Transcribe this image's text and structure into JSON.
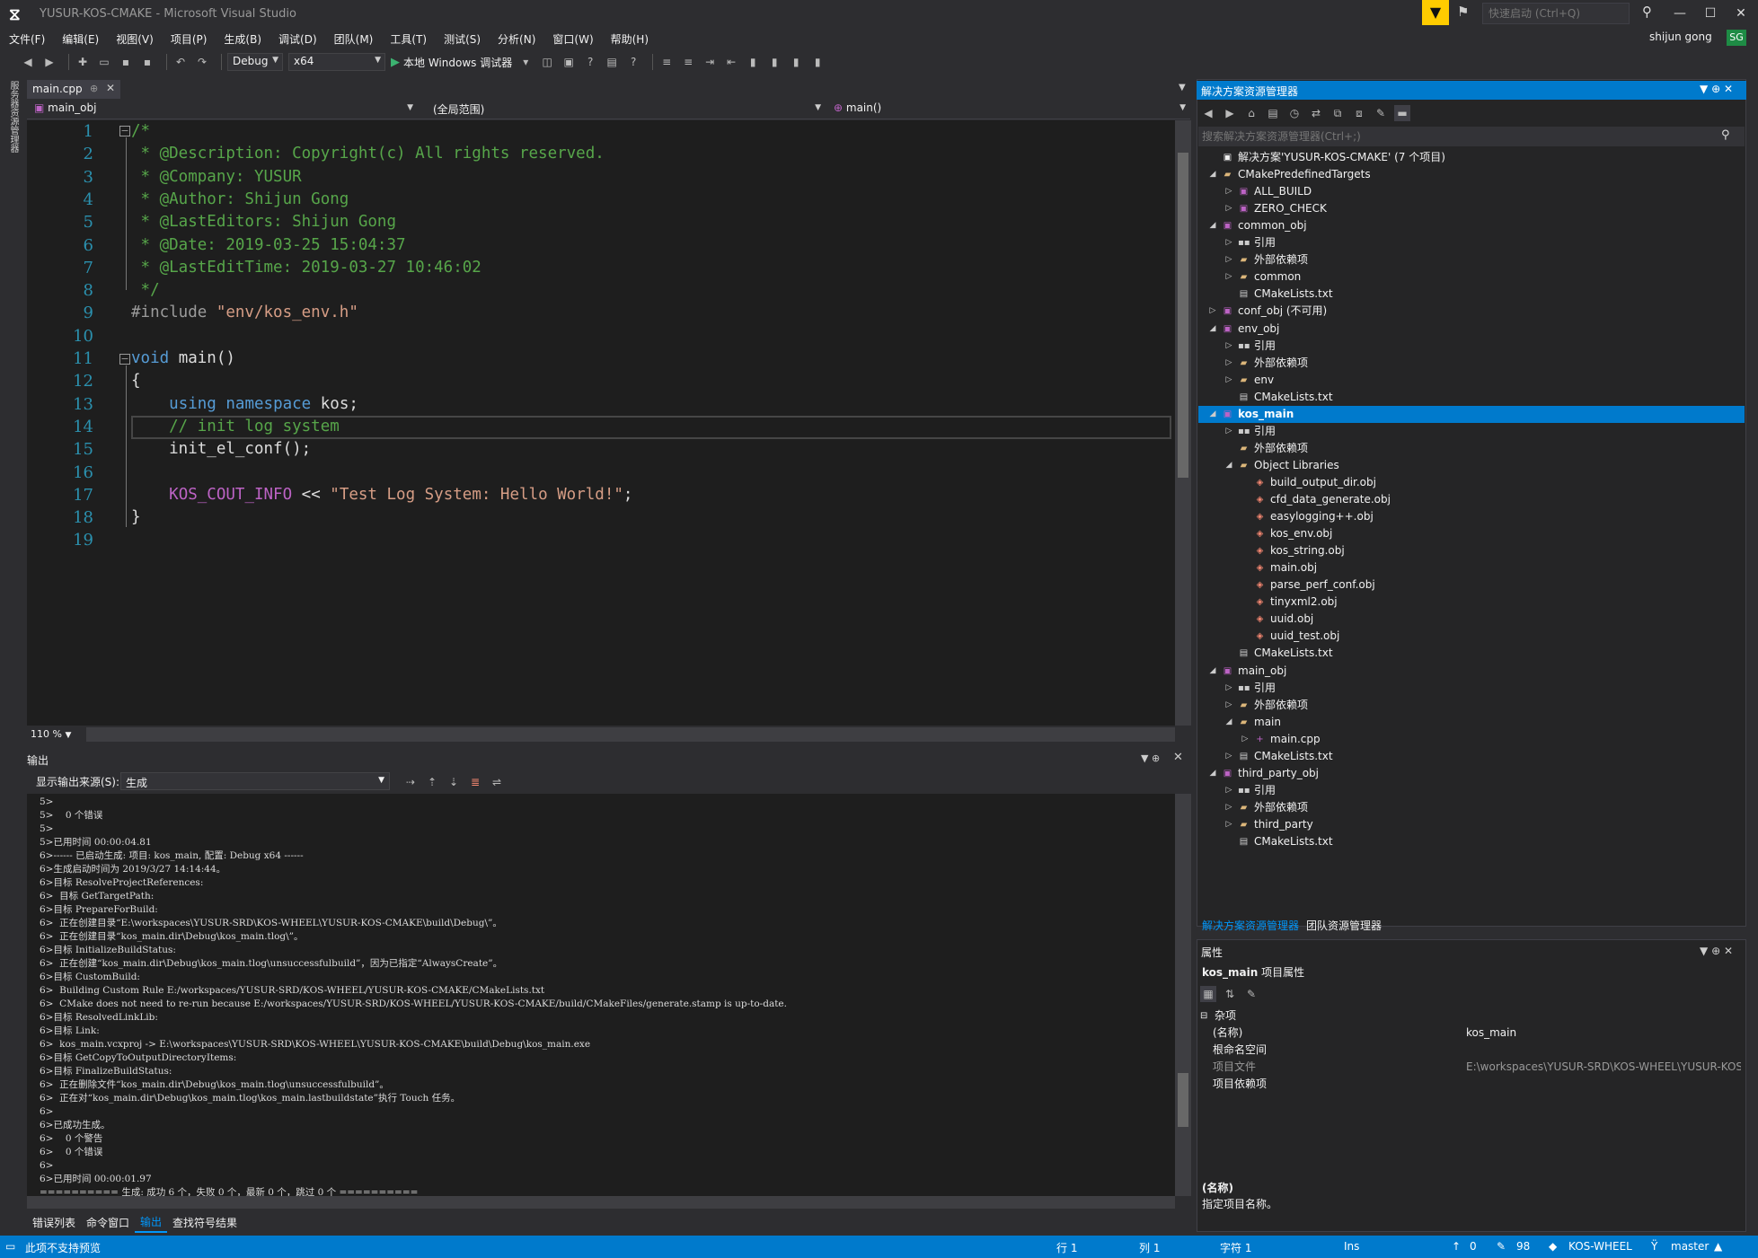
{
  "window": {
    "title": "YUSUR-KOS-CMAKE - Microsoft Visual Studio",
    "quick_launch_placeholder": "快速启动 (Ctrl+Q)",
    "user_name": "shijun gong",
    "user_initials": "SG"
  },
  "menu": [
    "文件(F)",
    "编辑(E)",
    "视图(V)",
    "项目(P)",
    "生成(B)",
    "调试(D)",
    "团队(M)",
    "工具(T)",
    "测试(S)",
    "分析(N)",
    "窗口(W)",
    "帮助(H)"
  ],
  "toolbar": {
    "config": "Debug",
    "platform": "x64",
    "run_label": "本地 Windows 调试器"
  },
  "left_strip_label": "服务器资源管理器",
  "editor": {
    "tab": "main.cpp",
    "nav_scope": "main_obj",
    "nav_global": "(全局范围)",
    "nav_func": "main()",
    "zoom": "110 %",
    "lines": [
      [
        {
          "t": "/*",
          "c": "comment"
        }
      ],
      [
        {
          "t": " * @Description: Copyright(c) All rights reserved.",
          "c": "comment"
        }
      ],
      [
        {
          "t": " * @Company: YUSUR",
          "c": "comment"
        }
      ],
      [
        {
          "t": " * @Author: Shijun Gong",
          "c": "comment"
        }
      ],
      [
        {
          "t": " * @LastEditors: Shijun Gong",
          "c": "comment"
        }
      ],
      [
        {
          "t": " * @Date: 2019-03-25 15:04:37",
          "c": "comment"
        }
      ],
      [
        {
          "t": " * @LastEditTime: 2019-03-27 10:46:02",
          "c": "comment"
        }
      ],
      [
        {
          "t": " */",
          "c": "comment"
        }
      ],
      [
        {
          "t": "#include ",
          "c": "pre"
        },
        {
          "t": "\"env/kos_env.h\"",
          "c": "str"
        }
      ],
      [],
      [
        {
          "t": "void",
          "c": "kw"
        },
        {
          "t": " main()",
          "c": "plain"
        }
      ],
      [
        {
          "t": "{",
          "c": "plain"
        }
      ],
      [
        {
          "t": "    ",
          "c": "plain"
        },
        {
          "t": "using",
          "c": "kw"
        },
        {
          "t": " ",
          "c": "plain"
        },
        {
          "t": "namespace",
          "c": "kw"
        },
        {
          "t": " kos;",
          "c": "plain"
        }
      ],
      [
        {
          "t": "    // init log system",
          "c": "comment"
        }
      ],
      [
        {
          "t": "    init_el_conf();",
          "c": "plain"
        }
      ],
      [],
      [
        {
          "t": "    ",
          "c": "plain"
        },
        {
          "t": "KOS_COUT_INFO",
          "c": "macro"
        },
        {
          "t": " << ",
          "c": "plain"
        },
        {
          "t": "\"Test Log System: Hello World!\"",
          "c": "str"
        },
        {
          "t": ";",
          "c": "plain"
        }
      ],
      [
        {
          "t": "}",
          "c": "plain"
        }
      ],
      []
    ]
  },
  "output": {
    "title": "输出",
    "source_label": "显示输出来源(S):",
    "source_value": "生成",
    "lines": [
      "5>",
      "5>    0 个错误",
      "5>",
      "5>已用时间 00:00:04.81",
      "6>------ 已启动生成: 项目: kos_main, 配置: Debug x64 ------",
      "6>生成启动时间为 2019/3/27 14:14:44。",
      "6>目标 ResolveProjectReferences:",
      "6>  目标 GetTargetPath:",
      "6>目标 PrepareForBuild:",
      "6>  正在创建目录“E:\\workspaces\\YUSUR-SRD\\KOS-WHEEL\\YUSUR-KOS-CMAKE\\build\\Debug\\”。",
      "6>  正在创建目录“kos_main.dir\\Debug\\kos_main.tlog\\”。",
      "6>目标 InitializeBuildStatus:",
      "6>  正在创建“kos_main.dir\\Debug\\kos_main.tlog\\unsuccessfulbuild”，因为已指定“AlwaysCreate”。",
      "6>目标 CustomBuild:",
      "6>  Building Custom Rule E:/workspaces/YUSUR-SRD/KOS-WHEEL/YUSUR-KOS-CMAKE/CMakeLists.txt",
      "6>  CMake does not need to re-run because E:/workspaces/YUSUR-SRD/KOS-WHEEL/YUSUR-KOS-CMAKE/build/CMakeFiles/generate.stamp is up-to-date.",
      "6>目标 ResolvedLinkLib:",
      "6>目标 Link:",
      "6>  kos_main.vcxproj -> E:\\workspaces\\YUSUR-SRD\\KOS-WHEEL\\YUSUR-KOS-CMAKE\\build\\Debug\\kos_main.exe",
      "6>目标 GetCopyToOutputDirectoryItems:",
      "6>目标 FinalizeBuildStatus:",
      "6>  正在删除文件“kos_main.dir\\Debug\\kos_main.tlog\\unsuccessfulbuild”。",
      "6>  正在对“kos_main.dir\\Debug\\kos_main.tlog\\kos_main.lastbuildstate”执行 Touch 任务。",
      "6>",
      "6>已成功生成。",
      "6>    0 个警告",
      "6>    0 个错误",
      "6>",
      "6>已用时间 00:00:01.97",
      "========== 生成: 成功 6 个，失败 0 个，最新 0 个，跳过 0 个 =========="
    ]
  },
  "bottom_tabs": [
    "错误列表",
    "命令窗口",
    "输出",
    "查找符号结果"
  ],
  "solution_explorer": {
    "title": "解决方案资源管理器",
    "search_placeholder": "搜索解决方案资源管理器(Ctrl+;)",
    "tree": [
      {
        "label": "解决方案'YUSUR-KOS-CMAKE' (7 个项目)",
        "level": 0,
        "icon": "sol",
        "tw": ""
      },
      {
        "label": "CMakePredefinedTargets",
        "level": 0,
        "icon": "folder",
        "tw": "open"
      },
      {
        "label": "ALL_BUILD",
        "level": 1,
        "icon": "proj",
        "tw": "closed"
      },
      {
        "label": "ZERO_CHECK",
        "level": 1,
        "icon": "proj",
        "tw": "closed"
      },
      {
        "label": "common_obj",
        "level": 0,
        "icon": "proj",
        "tw": "open"
      },
      {
        "label": "引用",
        "level": 1,
        "icon": "ref",
        "tw": "closed"
      },
      {
        "label": "外部依赖项",
        "level": 1,
        "icon": "folder",
        "tw": "closed"
      },
      {
        "label": "common",
        "level": 1,
        "icon": "folder",
        "tw": "closed"
      },
      {
        "label": "CMakeLists.txt",
        "level": 1,
        "icon": "file",
        "tw": ""
      },
      {
        "label": "conf_obj (不可用)",
        "level": 0,
        "icon": "proj",
        "tw": "closed"
      },
      {
        "label": "env_obj",
        "level": 0,
        "icon": "proj",
        "tw": "open"
      },
      {
        "label": "引用",
        "level": 1,
        "icon": "ref",
        "tw": "closed"
      },
      {
        "label": "外部依赖项",
        "level": 1,
        "icon": "folder",
        "tw": "closed"
      },
      {
        "label": "env",
        "level": 1,
        "icon": "folder",
        "tw": "closed"
      },
      {
        "label": "CMakeLists.txt",
        "level": 1,
        "icon": "file",
        "tw": ""
      },
      {
        "label": "kos_main",
        "level": 0,
        "icon": "proj",
        "tw": "open",
        "selected": true
      },
      {
        "label": "引用",
        "level": 1,
        "icon": "ref",
        "tw": "closed"
      },
      {
        "label": "外部依赖项",
        "level": 1,
        "icon": "folder",
        "tw": ""
      },
      {
        "label": "Object Libraries",
        "level": 1,
        "icon": "folder",
        "tw": "open"
      },
      {
        "label": "build_output_dir.obj",
        "level": 2,
        "icon": "obj",
        "tw": ""
      },
      {
        "label": "cfd_data_generate.obj",
        "level": 2,
        "icon": "obj",
        "tw": ""
      },
      {
        "label": "easylogging++.obj",
        "level": 2,
        "icon": "obj",
        "tw": ""
      },
      {
        "label": "kos_env.obj",
        "level": 2,
        "icon": "obj",
        "tw": ""
      },
      {
        "label": "kos_string.obj",
        "level": 2,
        "icon": "obj",
        "tw": ""
      },
      {
        "label": "main.obj",
        "level": 2,
        "icon": "obj",
        "tw": ""
      },
      {
        "label": "parse_perf_conf.obj",
        "level": 2,
        "icon": "obj",
        "tw": ""
      },
      {
        "label": "tinyxml2.obj",
        "level": 2,
        "icon": "obj",
        "tw": ""
      },
      {
        "label": "uuid.obj",
        "level": 2,
        "icon": "obj",
        "tw": ""
      },
      {
        "label": "uuid_test.obj",
        "level": 2,
        "icon": "obj",
        "tw": ""
      },
      {
        "label": "CMakeLists.txt",
        "level": 1,
        "icon": "file",
        "tw": ""
      },
      {
        "label": "main_obj",
        "level": 0,
        "icon": "proj",
        "tw": "open"
      },
      {
        "label": "引用",
        "level": 1,
        "icon": "ref",
        "tw": "closed"
      },
      {
        "label": "外部依赖项",
        "level": 1,
        "icon": "folder",
        "tw": "closed"
      },
      {
        "label": "main",
        "level": 1,
        "icon": "folder",
        "tw": "open"
      },
      {
        "label": "main.cpp",
        "level": 2,
        "icon": "cpp",
        "tw": "closed"
      },
      {
        "label": "CMakeLists.txt",
        "level": 1,
        "icon": "file",
        "tw": "closed"
      },
      {
        "label": "third_party_obj",
        "level": 0,
        "icon": "proj",
        "tw": "open"
      },
      {
        "label": "引用",
        "level": 1,
        "icon": "ref",
        "tw": "closed"
      },
      {
        "label": "外部依赖项",
        "level": 1,
        "icon": "folder",
        "tw": "closed"
      },
      {
        "label": "third_party",
        "level": 1,
        "icon": "folder",
        "tw": "closed"
      },
      {
        "label": "CMakeLists.txt",
        "level": 1,
        "icon": "file",
        "tw": ""
      }
    ],
    "bottom_tabs": [
      "解决方案资源管理器",
      "团队资源管理器"
    ]
  },
  "properties": {
    "title": "属性",
    "subject_name": "kos_main",
    "subject_type": "项目属性",
    "category": "杂项",
    "rows": [
      {
        "name": "(名称)",
        "value": "kos_main",
        "grey": false
      },
      {
        "name": "根命名空间",
        "value": "",
        "grey": false
      },
      {
        "name": "项目文件",
        "value": "E:\\workspaces\\YUSUR-SRD\\KOS-WHEEL\\YUSUR-KOS-CMAKE\\build\\kos_main.vcxproj",
        "grey": true
      },
      {
        "name": "项目依赖项",
        "value": "",
        "grey": false
      }
    ],
    "desc_name": "(名称)",
    "desc_text": "指定项目名称。"
  },
  "statusbar": {
    "message": "此项不支持预览",
    "row": "行 1",
    "col": "列 1",
    "char": "字符 1",
    "mode": "Ins",
    "up_count": "0",
    "edit_count": "98",
    "repo": "KOS-WHEEL",
    "branch": "master"
  }
}
